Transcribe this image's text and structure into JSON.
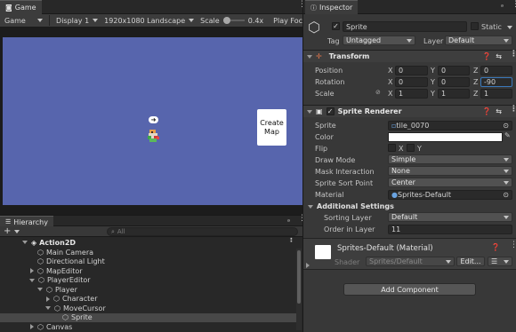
{
  "game": {
    "tab_label": "Game",
    "mode": "Game",
    "display": "Display 1",
    "resolution": "1920x1080 Landscape",
    "scale_label": "Scale",
    "scale_value": "0.4x",
    "play_focused": "Play Foc",
    "scale_slider_fraction": 0.0,
    "background_color": "#5765ad",
    "create_map_label": "Create\nMap"
  },
  "hierarchy": {
    "tab_label": "Hierarchy",
    "add_label": "+",
    "search_placeholder": "All",
    "scene_name": "Action2D",
    "items": [
      {
        "label": "Main Camera",
        "expanded": null
      },
      {
        "label": "Directional Light",
        "expanded": null
      },
      {
        "label": "MapEditor",
        "expanded": false
      },
      {
        "label": "PlayerEditor",
        "expanded": true
      },
      {
        "label": "Player",
        "expanded": true
      },
      {
        "label": "Character",
        "expanded": false
      },
      {
        "label": "MoveCursor",
        "expanded": true
      },
      {
        "label": "Sprite",
        "expanded": null
      },
      {
        "label": "Canvas",
        "expanded": false
      }
    ]
  },
  "inspector": {
    "tab_label": "Inspector",
    "object_name": "Sprite",
    "active": true,
    "static_label": "Static",
    "tag_label": "Tag",
    "tag_value": "Untagged",
    "layer_label": "Layer",
    "layer_value": "Default",
    "transform": {
      "title": "Transform",
      "position_label": "Position",
      "rotation_label": "Rotation",
      "scale_label": "Scale",
      "axes": [
        "X",
        "Y",
        "Z"
      ],
      "position": [
        "0",
        "0",
        "0"
      ],
      "rotation": [
        "0",
        "0",
        "-90"
      ],
      "scale": [
        "1",
        "1",
        "1"
      ]
    },
    "sprite_renderer": {
      "title": "Sprite Renderer",
      "sprite_label": "Sprite",
      "sprite_value": "tile_0070",
      "color_label": "Color",
      "color_value": "#ffffff",
      "flip_label": "Flip",
      "flip_x": "X",
      "flip_y": "Y",
      "draw_mode_label": "Draw Mode",
      "draw_mode": "Simple",
      "mask_label": "Mask Interaction",
      "mask": "None",
      "sort_point_label": "Sprite Sort Point",
      "sort_point": "Center",
      "material_label": "Material",
      "material": "Sprites-Default",
      "additional_label": "Additional Settings",
      "sorting_layer_label": "Sorting Layer",
      "sorting_layer": "Default",
      "order_label": "Order in Layer",
      "order": "11"
    },
    "material_card": {
      "name": "Sprites-Default (Material)",
      "shader_label": "Shader",
      "shader": "Sprites/Default",
      "edit_label": "Edit..."
    },
    "add_component": "Add Component"
  }
}
